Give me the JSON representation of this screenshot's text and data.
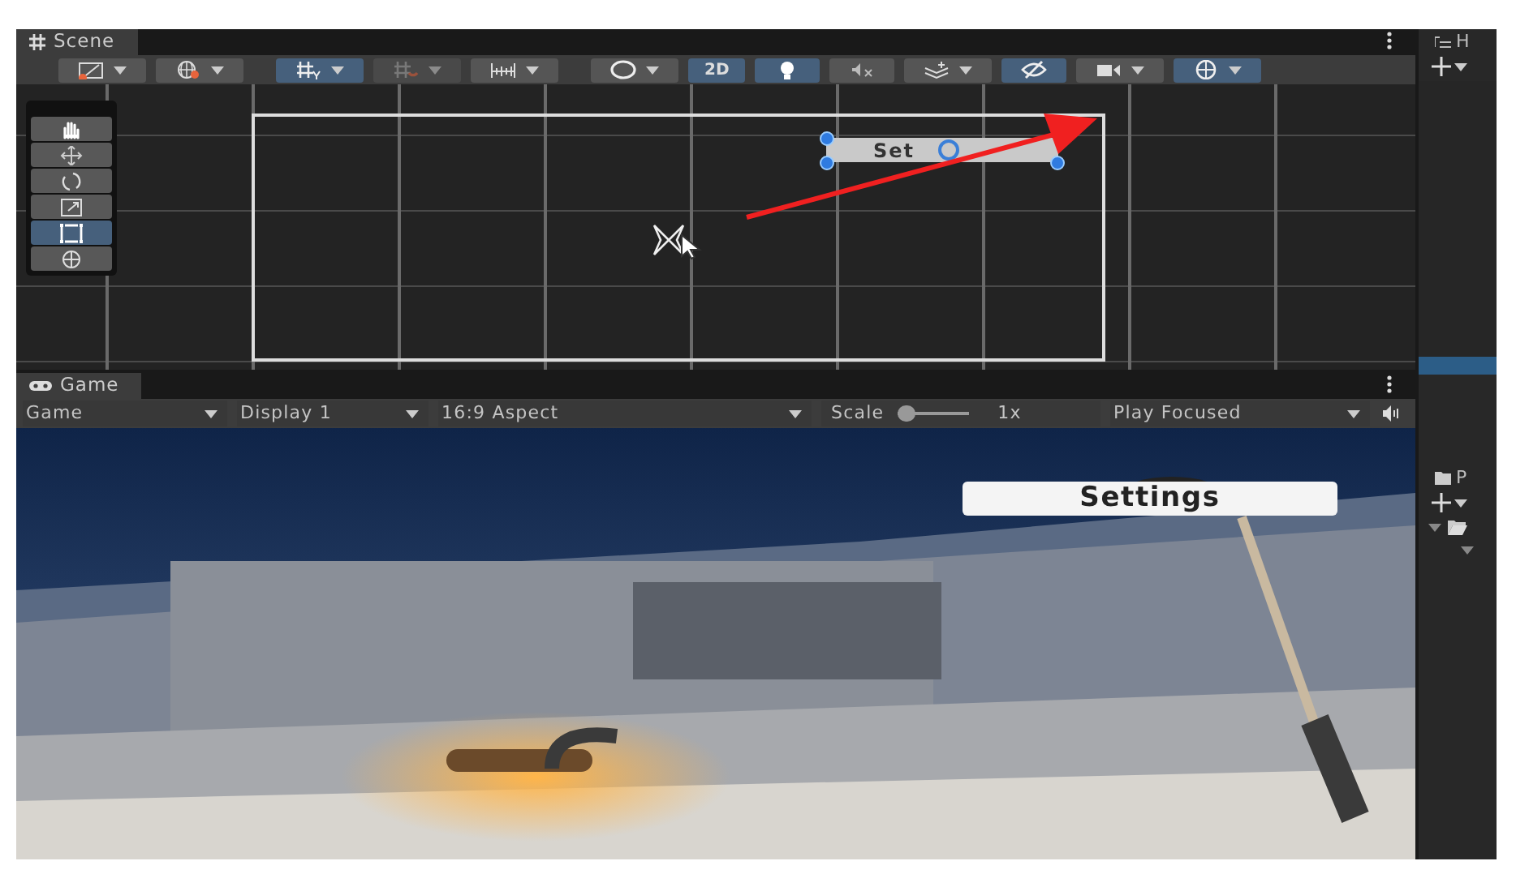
{
  "scene_panel": {
    "tab": {
      "label": "Scene",
      "selected": true
    },
    "toolbar": [
      {
        "kind": "icon",
        "dropdown": true,
        "selected": false,
        "disabled": false
      },
      {
        "kind": "icon",
        "dropdown": true,
        "selected": false,
        "disabled": false
      },
      {
        "kind": "icon",
        "dropdown": true,
        "selected": true,
        "disabled": false
      },
      {
        "kind": "icon",
        "dropdown": true,
        "selected": false,
        "disabled": true
      },
      {
        "kind": "icon",
        "dropdown": true,
        "selected": false,
        "disabled": false
      },
      {
        "kind": "icon",
        "dropdown": true,
        "selected": false,
        "disabled": false
      },
      {
        "kind": "text",
        "label": "2D",
        "dropdown": false,
        "selected": true,
        "disabled": false
      },
      {
        "kind": "icon",
        "dropdown": false,
        "selected": true,
        "disabled": false
      },
      {
        "kind": "icon",
        "dropdown": false,
        "selected": false,
        "disabled": false
      },
      {
        "kind": "icon",
        "dropdown": true,
        "selected": false,
        "disabled": false
      },
      {
        "kind": "icon",
        "dropdown": false,
        "selected": true,
        "disabled": false
      },
      {
        "kind": "icon",
        "dropdown": true,
        "selected": false,
        "disabled": false
      },
      {
        "kind": "icon",
        "dropdown": true,
        "selected": true,
        "disabled": false
      }
    ],
    "tools": [
      {
        "selected": false
      },
      {
        "selected": false
      },
      {
        "selected": false
      },
      {
        "selected": false
      },
      {
        "selected": true
      },
      {
        "selected": false
      }
    ],
    "canvas_element": {
      "label": "Set",
      "selected": true
    }
  },
  "game_panel": {
    "tab": {
      "label": "Game",
      "selected": true
    },
    "controls": [
      {
        "kind": "dropdown",
        "label": "Game"
      },
      {
        "kind": "dropdown",
        "label": "Display 1"
      },
      {
        "kind": "dropdown",
        "label": "16:9 Aspect"
      },
      {
        "kind": "slider",
        "label": "Scale",
        "level": 0,
        "reading": "1x"
      },
      {
        "kind": "dropdown",
        "label": "Play Focused"
      }
    ],
    "settings_button": {
      "label": "Settings"
    }
  },
  "hierarchy_panel": {
    "tab": {
      "label": "H"
    }
  },
  "project_panel": {
    "tab": {
      "label": "P"
    }
  }
}
